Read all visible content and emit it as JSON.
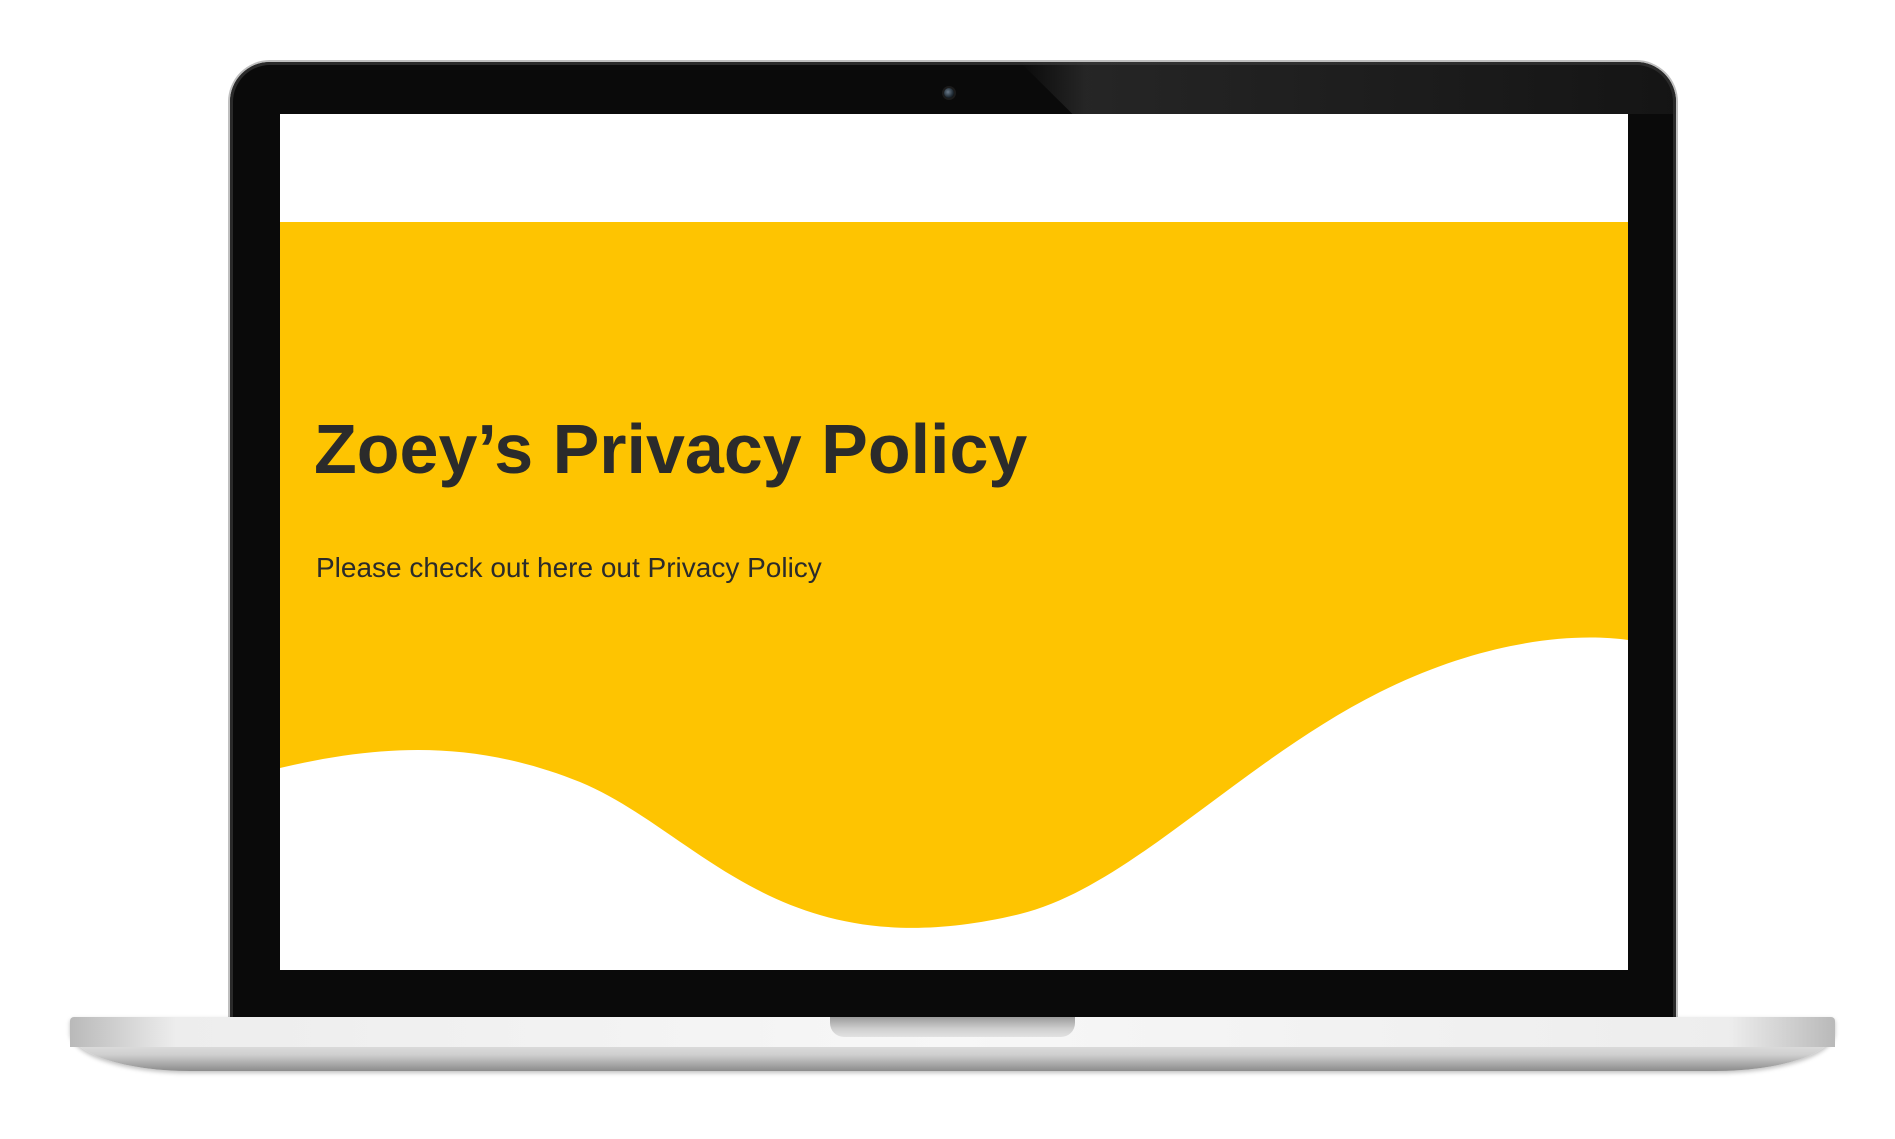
{
  "page": {
    "title": "Zoey’s Privacy Policy",
    "subtitle": "Please check out here out Privacy Policy"
  },
  "colors": {
    "hero_background": "#fec401",
    "text": "#2b2b2b",
    "screen_background": "#ffffff",
    "bezel": "#0a0a0a"
  },
  "device": {
    "type": "laptop-mockup",
    "camera_icon": "camera-icon"
  }
}
